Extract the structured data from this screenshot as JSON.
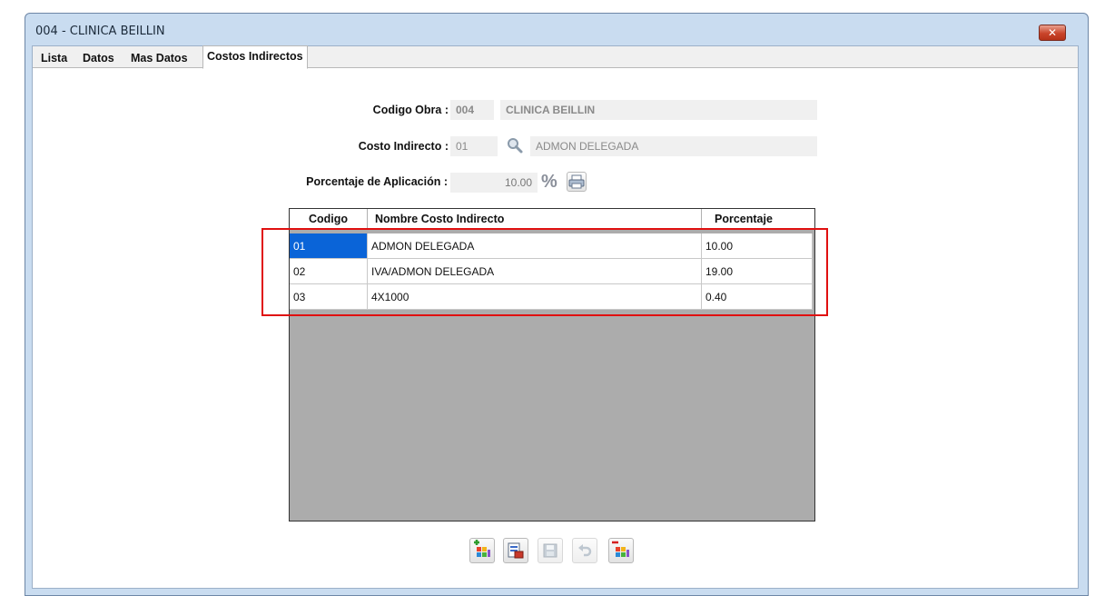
{
  "window": {
    "title": "004 - CLINICA BEILLIN",
    "close_glyph": "✕"
  },
  "tabs": [
    {
      "label": "Lista",
      "active": false
    },
    {
      "label": "Datos",
      "active": false
    },
    {
      "label": "Mas Datos",
      "active": false
    },
    {
      "label": "Costos Indirectos",
      "active": true
    }
  ],
  "form": {
    "codigo_obra_label": "Codigo Obra :",
    "codigo_obra_code": "004",
    "codigo_obra_name": "CLINICA BEILLIN",
    "costo_indirecto_label": "Costo Indirecto :",
    "costo_indirecto_code": "01",
    "costo_indirecto_name": "ADMON DELEGADA",
    "porcentaje_label": "Porcentaje de Aplicación :",
    "porcentaje_value": "10.00",
    "percent_glyph": "%"
  },
  "grid": {
    "columns": [
      "Codigo",
      "Nombre Costo Indirecto",
      "Porcentaje"
    ],
    "rows": [
      {
        "codigo": "01",
        "nombre": "ADMON DELEGADA",
        "porcentaje": "10.00",
        "selected": true
      },
      {
        "codigo": "02",
        "nombre": "IVA/ADMON DELEGADA",
        "porcentaje": "19.00",
        "selected": false
      },
      {
        "codigo": "03",
        "nombre": "4X1000",
        "porcentaje": "0.40",
        "selected": false
      }
    ]
  },
  "toolbar": [
    {
      "icon": "add-records-icon",
      "enabled": true
    },
    {
      "icon": "edit-record-icon",
      "enabled": true
    },
    {
      "icon": "save-icon",
      "enabled": false
    },
    {
      "icon": "undo-icon",
      "enabled": false
    },
    {
      "icon": "delete-records-icon",
      "enabled": true
    }
  ],
  "colors": {
    "selection": "#0a64d8",
    "highlight": "#e01010",
    "grid_background": "#acacac"
  }
}
